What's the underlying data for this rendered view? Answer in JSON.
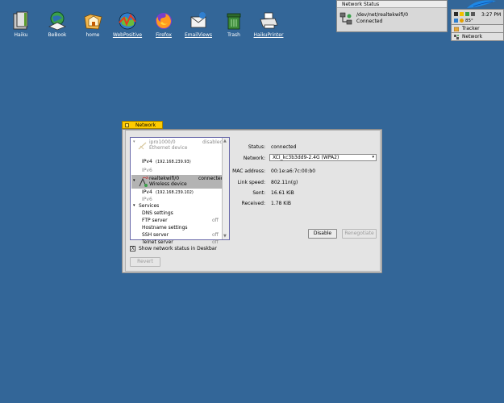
{
  "desktop": {
    "icons": [
      {
        "label": "Haiku",
        "icon": "haiku-disk-icon"
      },
      {
        "label": "BeBook",
        "icon": "bebook-icon"
      },
      {
        "label": "home",
        "icon": "home-folder-icon"
      },
      {
        "label": "WebPositive",
        "icon": "webpositive-icon"
      },
      {
        "label": "Firefox",
        "icon": "firefox-icon"
      },
      {
        "label": "EmailViews",
        "icon": "emailviews-icon"
      },
      {
        "label": "Trash",
        "icon": "trash-icon"
      },
      {
        "label": "HaikuPrinter",
        "icon": "printer-icon"
      }
    ],
    "background": "#336698"
  },
  "network_status": {
    "title": "Network Status",
    "device": "/dev/net/realtekwifi/0",
    "state": "Connected"
  },
  "deskbar": {
    "clock": "3:27 PM",
    "temperature": "85°",
    "entries": [
      {
        "label": "Tracker",
        "icon": "tracker-icon"
      },
      {
        "label": "Network",
        "icon": "network-icon"
      }
    ]
  },
  "window": {
    "title": "Network",
    "tree": {
      "eth_name": "ipro1000/0",
      "eth_status": "disabled",
      "eth_type": "Ethernet device",
      "eth_ipv4_label": "IPv4",
      "eth_ipv4": "(192.168.239.93)",
      "eth_ipv6_label": "IPv6",
      "wifi_name": "realtekwifi/0",
      "wifi_status": "connected",
      "wifi_type": "Wireless device",
      "wifi_ipv4_label": "IPv4",
      "wifi_ipv4": "(192.168.239.102)",
      "wifi_ipv6_label": "IPv6",
      "services_label": "Services",
      "services": [
        {
          "name": "DNS settings",
          "status": ""
        },
        {
          "name": "FTP server",
          "status": "off"
        },
        {
          "name": "Hostname settings",
          "status": ""
        },
        {
          "name": "SSH server",
          "status": "off"
        },
        {
          "name": "Telnet server",
          "status": "off"
        }
      ]
    },
    "details": {
      "status_label": "Status:",
      "status_value": "connected",
      "network_label": "Network:",
      "network_value": "XCI_kc3b3dd9-2.4G (WPA2)",
      "mac_label": "MAC address:",
      "mac_value": "00:1e:a6:7c:00:b0",
      "speed_label": "Link speed:",
      "speed_value": "802.11n(g)",
      "sent_label": "Sent:",
      "sent_value": "16.61 KiB",
      "received_label": "Received:",
      "received_value": "1.78 KiB"
    },
    "buttons": {
      "disable": "Disable",
      "renegotiate": "Renegotiate",
      "revert": "Revert"
    },
    "show_in_deskbar_label": "Show network status in Deskbar",
    "show_in_deskbar_checked": "X"
  }
}
